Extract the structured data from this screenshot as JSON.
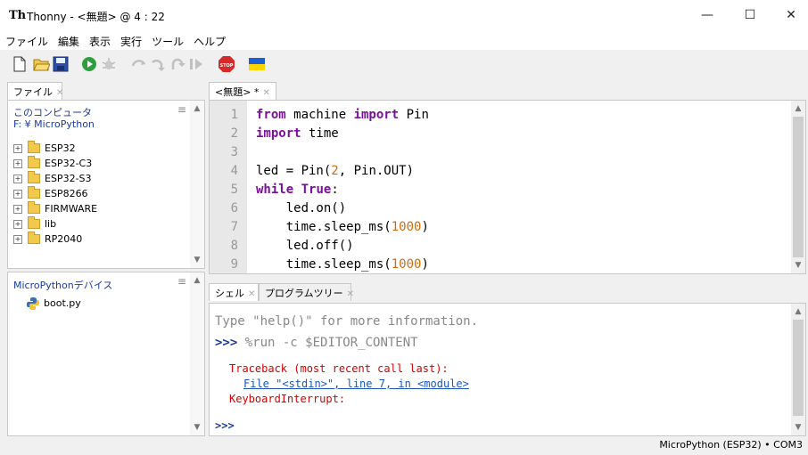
{
  "window": {
    "title": "Thonny  -  <無題>  @  4 : 22",
    "app_icon": "Th"
  },
  "menu": [
    "ファイル",
    "編集",
    "表示",
    "実行",
    "ツール",
    "ヘルプ"
  ],
  "toolbar": [
    "new-file-icon",
    "open-folder-icon",
    "save-icon",
    "run-icon",
    "debug-icon",
    "step-over-icon",
    "step-into-icon",
    "step-out-icon",
    "resume-icon",
    "stop-icon",
    "ukraine-flag-icon"
  ],
  "files_tab": {
    "label": "ファイル"
  },
  "local_pane": {
    "title": "このコンピュータ",
    "path": "F: ¥ MicroPython",
    "items": [
      "ESP32",
      "ESP32-C3",
      "ESP32-S3",
      "ESP8266",
      "FIRMWARE",
      "lib",
      "RP2040"
    ]
  },
  "device_pane": {
    "title": "MicroPythonデバイス",
    "items": [
      "boot.py"
    ]
  },
  "editor_tab": {
    "label": "<無題> *"
  },
  "editor": {
    "line_numbers": [
      "1",
      "2",
      "3",
      "4",
      "5",
      "6",
      "7",
      "8",
      "9"
    ]
  },
  "shell_tabs": [
    "シェル",
    "プログラムツリー"
  ],
  "shell": {
    "help_line": "Type \"help()\" for more information.",
    "prompt": ">>>",
    "command": " %run -c $EDITOR_CONTENT",
    "traceback": "Traceback (most recent call last):",
    "file_link": "File \"<stdin>\", line 7, in <module>",
    "error": "KeyboardInterrupt:",
    "current_prompt": ">>>"
  },
  "status": "MicroPython (ESP32)  •  COM3",
  "colors": {
    "keyword": "#7a0f9a",
    "number": "#d36b00",
    "error": "#d40000",
    "link": "#1a55c0",
    "prompt": "#1a3aa0"
  }
}
